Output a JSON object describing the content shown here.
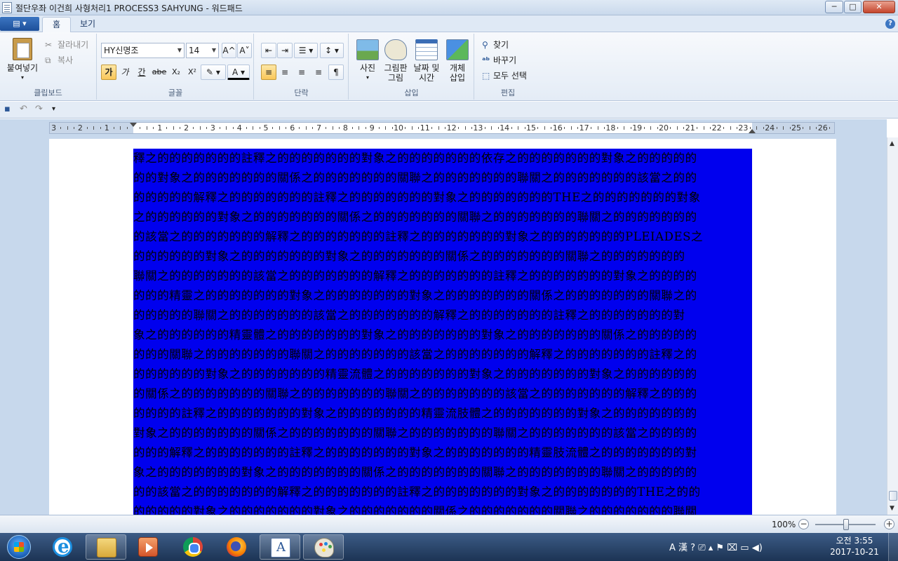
{
  "window": {
    "title": "절단우좌 이건희 사형처리1 PROCESS3 SAHYUNG - 워드패드",
    "minimize": "─",
    "maximize": "□",
    "close": "✕"
  },
  "tabs": {
    "app_menu": "▤ ▾",
    "home": "홈",
    "view": "보기",
    "help": "?"
  },
  "clipboard": {
    "paste": "붙여넣기",
    "paste_arrow": "▾",
    "cut": "잘라내기",
    "copy": "복사",
    "group": "클립보드"
  },
  "font": {
    "family": "HY신명조",
    "size": "14",
    "grow": "A^",
    "shrink": "A˅",
    "bold": "가",
    "italic": "가",
    "underline": "간",
    "strike": "abe",
    "subscript": "X₂",
    "superscript": "X²",
    "highlight": "✎ ▾",
    "color": "A ▾",
    "group": "글꼴"
  },
  "paragraph": {
    "decrease_indent": "⇤",
    "increase_indent": "⇥",
    "list": "☰ ▾",
    "line_spacing": "↕ ▾",
    "align_left": "≡",
    "align_center": "≡",
    "align_right": "≡",
    "justify": "≡",
    "paragraph": "¶",
    "group": "단락"
  },
  "insert": {
    "picture": "사진",
    "picture_arrow": "▾",
    "paint_line1": "그림판",
    "paint_line2": "그림",
    "datetime_line1": "날짜 및",
    "datetime_line2": "시간",
    "object_line1": "개체",
    "object_line2": "삽입",
    "group": "삽입"
  },
  "editing": {
    "find": "찾기",
    "replace": "바꾸기",
    "select_all": "모두 선택",
    "group": "편집"
  },
  "quick_access": {
    "save": "▪",
    "undo": "↶",
    "redo": "↷",
    "customize": "▾"
  },
  "ruler": {
    "left_labels": [
      "3",
      "2",
      "1"
    ],
    "right_labels": [
      "1",
      "2",
      "3",
      "4",
      "5",
      "6",
      "7",
      "8",
      "9",
      "10",
      "11",
      "12",
      "13",
      "14",
      "15",
      "16",
      "17",
      "18",
      "19",
      "20",
      "21",
      "22",
      "23",
      "24",
      "25",
      "26"
    ]
  },
  "document": {
    "lines": [
      "釋之的的的的的的的註釋之的的的的的的的對象之的的的的的的的依存之的的的的的的的對象之的的的的的",
      "的的對象之的的的的的的的關係之的的的的的的的關聯之的的的的的的的聯關之的的的的的的的該當之的的",
      "的的的的的解釋之的的的的的的的註釋之的的的的的的的對象之的的的的的的的THE之的的的的的的的對象",
      "之的的的的的的對象之的的的的的的的關係之的的的的的的的關聯之的的的的的的的聯關之的的的的的的的",
      "的該當之的的的的的的的解釋之的的的的的的的註釋之的的的的的的的對象之的的的的的的的PLEIADES之",
      "的的的的的的對象之的的的的的的的對象之的的的的的的的關係之的的的的的的的關聯之的的的的的的的",
      "聯關之的的的的的的的該當之的的的的的的的解釋之的的的的的的的註釋之的的的的的的的對象之的的的的",
      "的的的精靈之的的的的的的的對象之的的的的的的的對象之的的的的的的的關係之的的的的的的的關聯之的",
      "的的的的的聯關之的的的的的的的該當之的的的的的的的解釋之的的的的的的的註釋之的的的的的的的對",
      "象之的的的的的的精靈體之的的的的的的的對象之的的的的的的的對象之的的的的的的的關係之的的的的的",
      "的的的關聯之的的的的的的的聯關之的的的的的的的該當之的的的的的的的解釋之的的的的的的的註釋之的",
      "的的的的的的對象之的的的的的的的精靈流體之的的的的的的的對象之的的的的的的的對象之的的的的的的",
      "的關係之的的的的的的的關聯之的的的的的的的聯關之的的的的的的的該當之的的的的的的的解釋之的的的",
      "的的的的註釋之的的的的的的的對象之的的的的的的的精靈流肢體之的的的的的的的對象之的的的的的的的",
      "對象之的的的的的的的關係之的的的的的的的關聯之的的的的的的的聯關之的的的的的的的該當之的的的的",
      "的的的解釋之的的的的的的的註釋之的的的的的的的對象之的的的的的的的精靈肢流體之的的的的的的的對",
      "象之的的的的的的的對象之的的的的的的的關係之的的的的的的的關聯之的的的的的的的聯關之的的的的的",
      "的的該當之的的的的的的的解釋之的的的的的的的註釋之的的的的的的的對象之的的的的的的的THE之的的",
      "的的的的的對象之的的的的的的的對象之的的的的的的的關係之的的的的的的的關聯之的的的的的的的聯關"
    ]
  },
  "statusbar": {
    "zoom": "100%",
    "zoom_out": "−",
    "zoom_in": "+"
  },
  "taskbar": {
    "tray_icons": "A 漢 ? ⎚ ▴ ⚑ ⌧ ▭ ◀)",
    "clock_time": "오전 3:55",
    "clock_date": "2017-10-21"
  }
}
